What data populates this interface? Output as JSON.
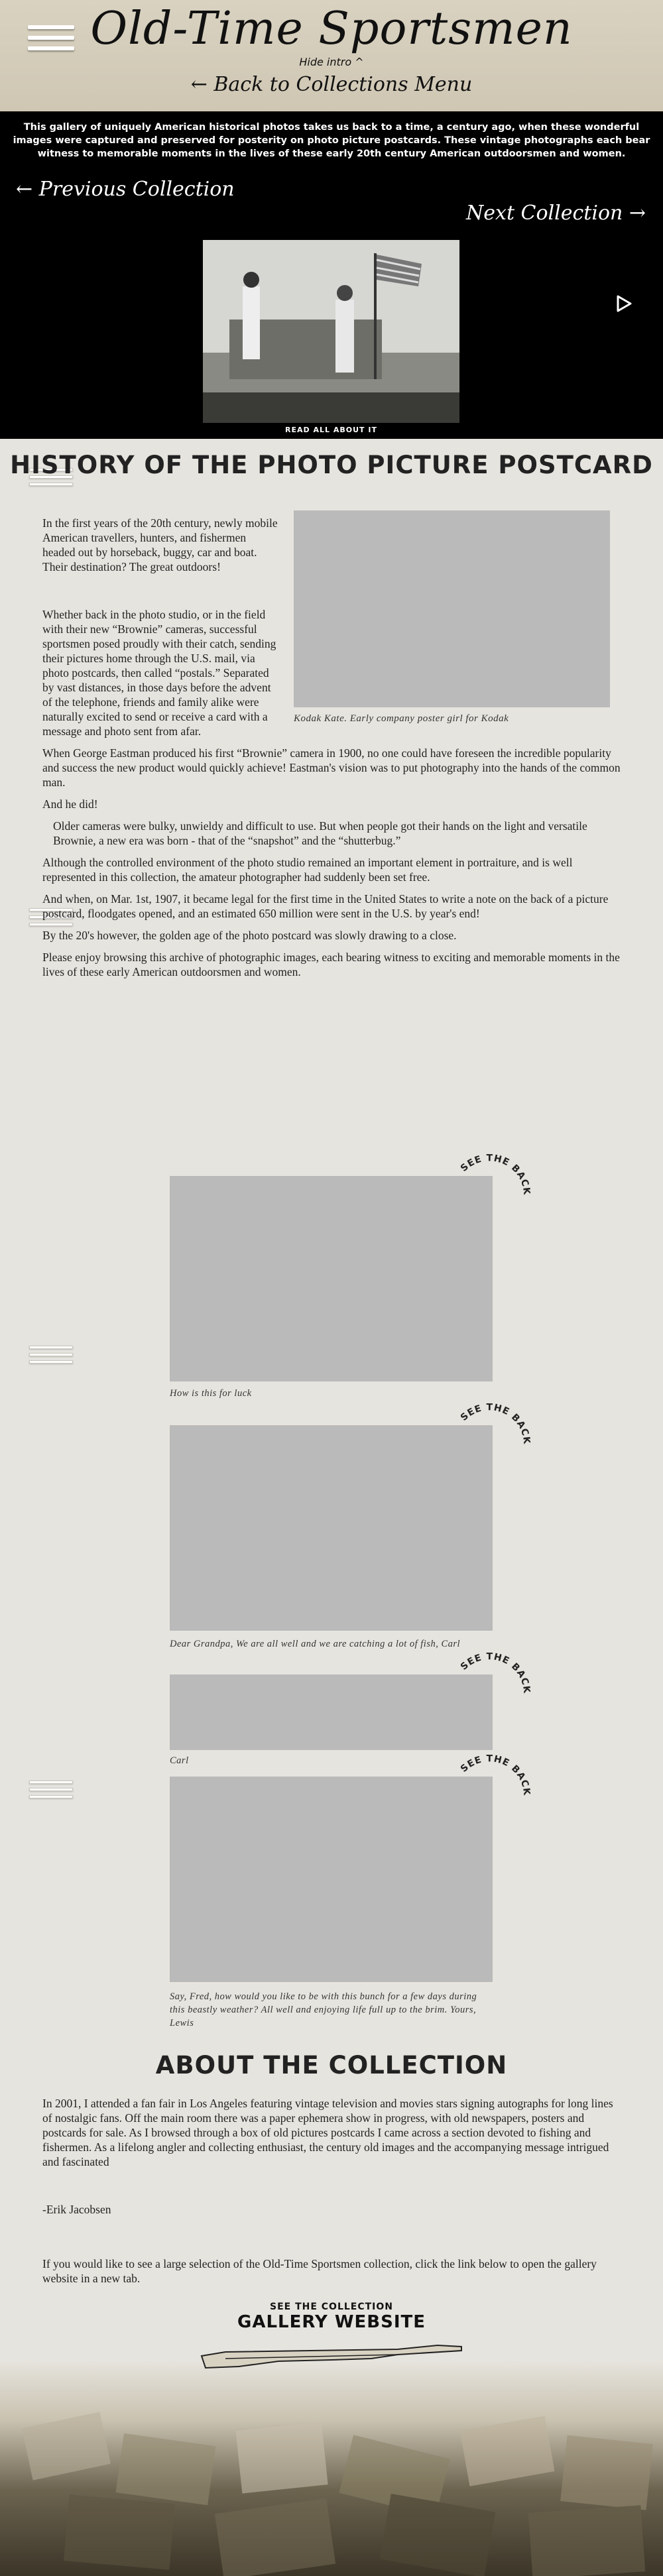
{
  "header": {
    "site_title": "Old-Time Sportsmen",
    "hide_intro_label": "Hide intro ^",
    "back_label": "← Back to Collections Menu"
  },
  "intro": {
    "text": "This gallery of uniquely American historical photos takes us back to a time, a century ago, when these wonderful images were captured and preserved for posterity on photo picture postcards. These vintage photographs each bear witness to memorable moments in the lives of these early 20th century American outdoorsmen and women.",
    "prev_label": "← Previous Collection",
    "next_label": "Next Collection →",
    "read_all_label": "READ ALL ABOUT IT"
  },
  "history": {
    "title": "HISTORY OF THE PHOTO PICTURE POSTCARD",
    "figure_caption": "Kodak Kate. Early company poster girl for Kodak",
    "p1": "In the first years of the 20th century, newly mobile American travellers, hunters, and fishermen headed out by horseback, buggy, car and boat. Their destination? The great outdoors!",
    "p2": "Whether back in the photo studio, or in the field with their new “Brownie” cameras, successful sportsmen posed proudly with their catch, sending their pictures home through the U.S. mail, via photo postcards, then called “postals.” Separated by vast distances, in those days before the advent of the telephone, friends and family alike were naturally excited to send or receive a card with a message and photo sent from afar.",
    "p3": "When George Eastman produced his first “Brownie” camera in 1900, no one could have foreseen the incredible popularity and success the new product would quickly achieve! Eastman's vision was to put photography into the hands of the common man.",
    "p4": "And he did!",
    "quote": "Older cameras were bulky, unwieldy and difficult to use. But when people got their hands on the light and versatile Brownie, a new era was born - that of the “snapshot” and the “shutterbug.”",
    "p5": "Although the controlled environment of the photo studio remained an important element in portraiture, and is well represented in this collection, the amateur photographer had suddenly been set free.",
    "p6": "And when, on Mar. 1st, 1907, it became legal for the first time in the United States to write a note on the back of a picture postcard, floodgates opened, and an estimated 650 million were sent in the U.S. by year's end!",
    "p7": "By the 20's however, the golden age of the photo postcard was slowly drawing to a close.",
    "p8": "Please enjoy browsing this archive of photographic images, each bearing witness to exciting and memorable moments in the lives of these early American outdoorsmen and women."
  },
  "postcards": [
    {
      "see_back": "SEE THE BACK",
      "caption": "How is this for luck"
    },
    {
      "see_back": "SEE THE BACK",
      "caption": "Dear Grandpa, We are all well and we are catching a lot of fish, Carl"
    },
    {
      "see_back": "SEE THE BACK",
      "caption": "Carl"
    },
    {
      "see_back": "SEE THE BACK",
      "caption": "Say, Fred, how would you like to be with this bunch for a few days during this beastly weather? All well and enjoying life full up to the brim. Yours, Lewis"
    }
  ],
  "about": {
    "title": "ABOUT THE COLLECTION",
    "p1": "In 2001, I attended a fan fair in Los Angeles featuring vintage television and movies stars signing autographs for long lines of nostalgic fans. Off the main room there was a paper ephemera show in progress, with old newspapers, posters and postcards for sale. As I browsed through a box of old pictures postcards I came across a section devoted to fishing and fishermen. As a lifelong angler and collecting enthusiast, the century old images and the accompanying message intrigued and fascinated",
    "signature": "-Erik Jacobsen",
    "p2": "If you would like to see a large selection of the Old-Time Sportsmen collection, click the link below to open the gallery website in a new tab.",
    "gallery_pre": "SEE THE COLLECTION",
    "gallery_main": "GALLERY WEBSITE"
  },
  "icons": {
    "menu": "hamburger-icon",
    "play": "play-icon",
    "rifle": "rifle-icon"
  },
  "colors": {
    "header_bg": "#d3cbb8",
    "intro_bg": "#000000",
    "page_bg": "#e6e4de",
    "placeholder": "#bababa"
  }
}
